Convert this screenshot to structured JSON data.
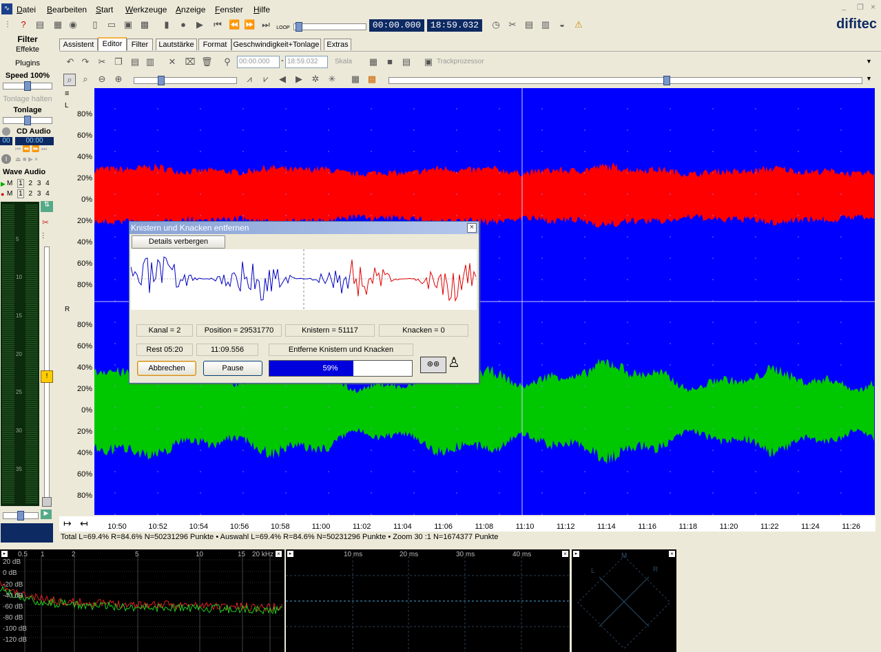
{
  "menu": [
    "Datei",
    "Bearbeiten",
    "Start",
    "Werkzeuge",
    "Anzeige",
    "Fenster",
    "Hilfe"
  ],
  "toolbar": {
    "time_current": "00:00.000",
    "time_total": "18:59.032",
    "loop_label": "LOOP"
  },
  "logo": "difitec",
  "left_panel": {
    "filter": "Filter",
    "effekte": "Effekte",
    "plugins": "Plugins",
    "speed": "Speed 100%",
    "tonlage_halten": "Tonlage halten",
    "tonlage": "Tonlage",
    "cd_audio": "CD Audio",
    "cd_track": "00",
    "cd_time": "00:00",
    "wave_audio": "Wave Audio",
    "play_row": [
      "M",
      "1",
      "2",
      "3",
      "4"
    ],
    "rec_row": [
      "M",
      "1",
      "2",
      "3",
      "4"
    ],
    "meter_scale": [
      "5",
      "10",
      "15",
      "20",
      "25",
      "30",
      "35"
    ]
  },
  "tabs": [
    "Assistent",
    "Editor",
    "Filter",
    "Lautstärke",
    "Format",
    "Geschwindigkeit+Tonlage",
    "Extras"
  ],
  "editbar": {
    "sel_start": "00:00.000",
    "sel_sep": "-",
    "sel_end": "18:59.032",
    "skala": "Skala",
    "trackprozessor": "Trackprozessor"
  },
  "wave": {
    "channel_left": "L",
    "channel_right": "R",
    "y_labels_left": [
      "80%",
      "60%",
      "40%",
      "20%",
      "0%",
      "20%",
      "40%",
      "60%",
      "80%"
    ],
    "y_labels_right": [
      "80%",
      "60%",
      "40%",
      "20%",
      "0%",
      "20%",
      "40%",
      "60%",
      "80%"
    ],
    "colors": {
      "background": "#0000ff",
      "left": "#ff0000",
      "right": "#00c800"
    }
  },
  "time_axis": [
    "10:50",
    "10:52",
    "10:54",
    "10:56",
    "10:58",
    "11:00",
    "11:02",
    "11:04",
    "11:06",
    "11:08",
    "11:10",
    "11:12",
    "11:14",
    "11:16",
    "11:18",
    "11:20",
    "11:22",
    "11:24",
    "11:26"
  ],
  "status": "Total L=69.4% R=84.6% N=50231296 Punkte • Auswahl L=69.4% R=84.6% N=50231296 Punkte • Zoom 30 :1 N=1674377 Punkte",
  "spectrum": {
    "x_labels": [
      "0.5",
      "1",
      "2",
      "5",
      "10",
      "15",
      "20 kHz"
    ],
    "y_labels": [
      "20 dB",
      "0 dB",
      "-20 dB",
      "-40 dB",
      "-60 dB",
      "-80 dB",
      "-100 dB",
      "-120 dB"
    ]
  },
  "scope": {
    "x_labels": [
      "10 ms",
      "20 ms",
      "30 ms",
      "40 ms"
    ]
  },
  "goniometer": {
    "m": "M",
    "l": "L",
    "r": "R"
  },
  "dialog": {
    "title": "Knistern und Knacken entfernen",
    "details_button": "Details verbergen",
    "kanal": "Kanal = 2",
    "position": "Position = 29531770",
    "knistern": "Knistern = 51117",
    "knacken": "Knacken = 0",
    "rest": "Rest 05:20",
    "elapsed": "11:09.556",
    "status": "Entferne Knistern und Knacken",
    "cancel_button": "Abbrechen",
    "pause_button": "Pause",
    "progress_text": "59%",
    "progress": 0.59
  }
}
